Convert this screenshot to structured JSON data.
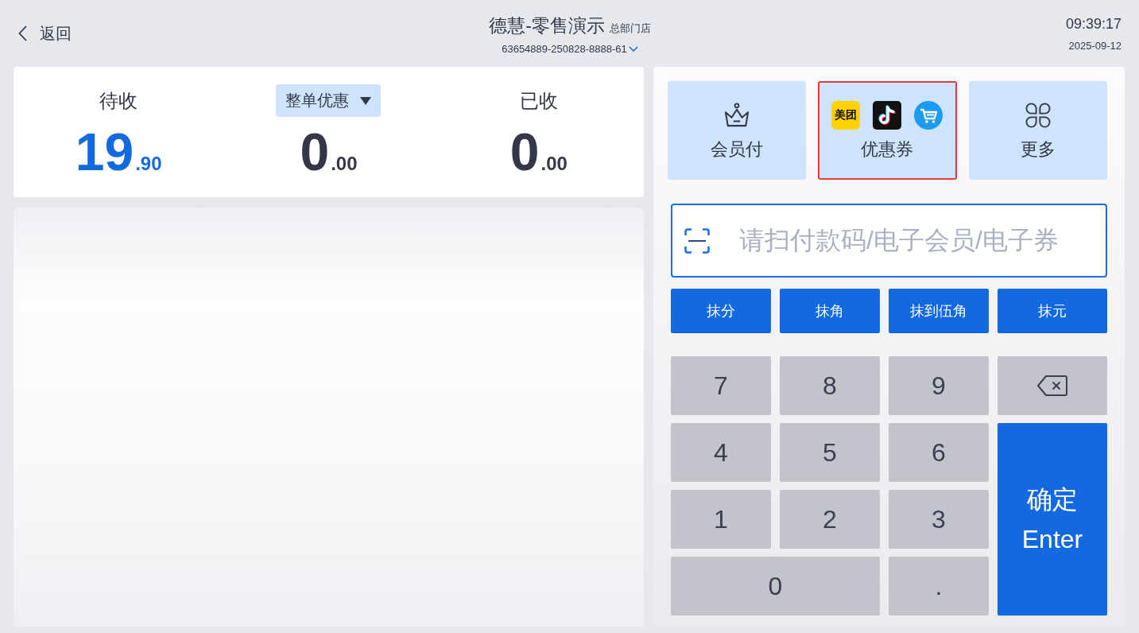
{
  "header": {
    "back_label": "返回",
    "title": "德慧-零售演示",
    "store": "总部门店",
    "order_number": "63654889-250828-8888-61",
    "time": "09:39:17",
    "date": "2025-09-12"
  },
  "summary": [
    {
      "kind": "label",
      "label": "待收",
      "integer": "19",
      "fraction": ".90",
      "highlight": true
    },
    {
      "kind": "dropdown",
      "label": "整单优惠",
      "integer": "0",
      "fraction": ".00",
      "highlight": false
    },
    {
      "kind": "label",
      "label": "已收",
      "integer": "0",
      "fraction": ".00",
      "highlight": false
    }
  ],
  "payment_methods": [
    {
      "kind": "member",
      "label": "会员付",
      "selected": false
    },
    {
      "kind": "coupon",
      "label": "优惠券",
      "logo_text": "美团",
      "selected": true
    },
    {
      "kind": "more",
      "label": "更多",
      "selected": false
    }
  ],
  "scan_field": {
    "placeholder": "请扫付款码/电子会员/电子券"
  },
  "rounding_buttons": [
    "抹分",
    "抹角",
    "抹到伍角",
    "抹元"
  ],
  "keypad": [
    {
      "kind": "digit",
      "label": "7"
    },
    {
      "kind": "digit",
      "label": "8"
    },
    {
      "kind": "digit",
      "label": "9"
    },
    {
      "kind": "backspace"
    },
    {
      "kind": "digit",
      "label": "4"
    },
    {
      "kind": "digit",
      "label": "5"
    },
    {
      "kind": "digit",
      "label": "6"
    },
    {
      "kind": "digit",
      "label": "1"
    },
    {
      "kind": "digit",
      "label": "2"
    },
    {
      "kind": "digit",
      "label": "3"
    },
    {
      "kind": "wide-digit",
      "label": "0"
    },
    {
      "kind": "digit",
      "label": "."
    },
    {
      "kind": "confirm",
      "label": "确定",
      "sublabel": "Enter"
    }
  ]
}
